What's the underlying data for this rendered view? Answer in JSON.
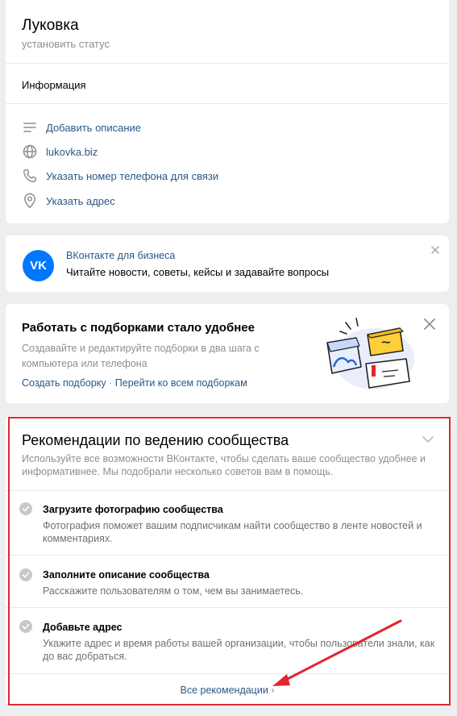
{
  "profile": {
    "name": "Луковка",
    "status_placeholder": "установить статус",
    "info_heading": "Информация",
    "rows": [
      {
        "icon": "list-icon",
        "label": "Добавить описание"
      },
      {
        "icon": "globe-icon",
        "label": "lukovka.biz"
      },
      {
        "icon": "phone-icon",
        "label": "Указать номер телефона для связи"
      },
      {
        "icon": "location-icon",
        "label": "Указать адрес"
      }
    ]
  },
  "business": {
    "logo_text": "VK",
    "title": "ВКонтакте для бизнеса",
    "text": "Читайте новости, советы, кейсы и задавайте вопросы"
  },
  "collections": {
    "title": "Работать с подборками стало удобнее",
    "description": "Создавайте и редактируйте подборки в два шага с компьютера или телефона",
    "link_create": "Создать подборку",
    "separator": "·",
    "link_all": "Перейти ко всем подборкам"
  },
  "recommendations": {
    "title": "Рекомендации по ведению сообщества",
    "description": "Используйте все возможности ВКонтакте, чтобы сделать ваше сообщество удобнее и информативнее. Мы подобрали несколько советов вам в помощь.",
    "items": [
      {
        "title": "Загрузите фотографию сообщества",
        "text": "Фотография поможет вашим подписчикам найти сообщество в ленте новостей и комментариях."
      },
      {
        "title": "Заполните описание сообщества",
        "text": "Расскажите пользователям о том, чем вы занимаетесь."
      },
      {
        "title": "Добавьте адрес",
        "text": "Укажите адрес и время работы вашей организации, чтобы пользователи знали, как до вас добраться."
      }
    ],
    "all_link": "Все рекомендации",
    "all_link_chevron": "›"
  },
  "colors": {
    "link": "#2a5885",
    "vk_blue": "#0077ff",
    "highlight_red": "#e2262e",
    "background": "#edeef0"
  }
}
